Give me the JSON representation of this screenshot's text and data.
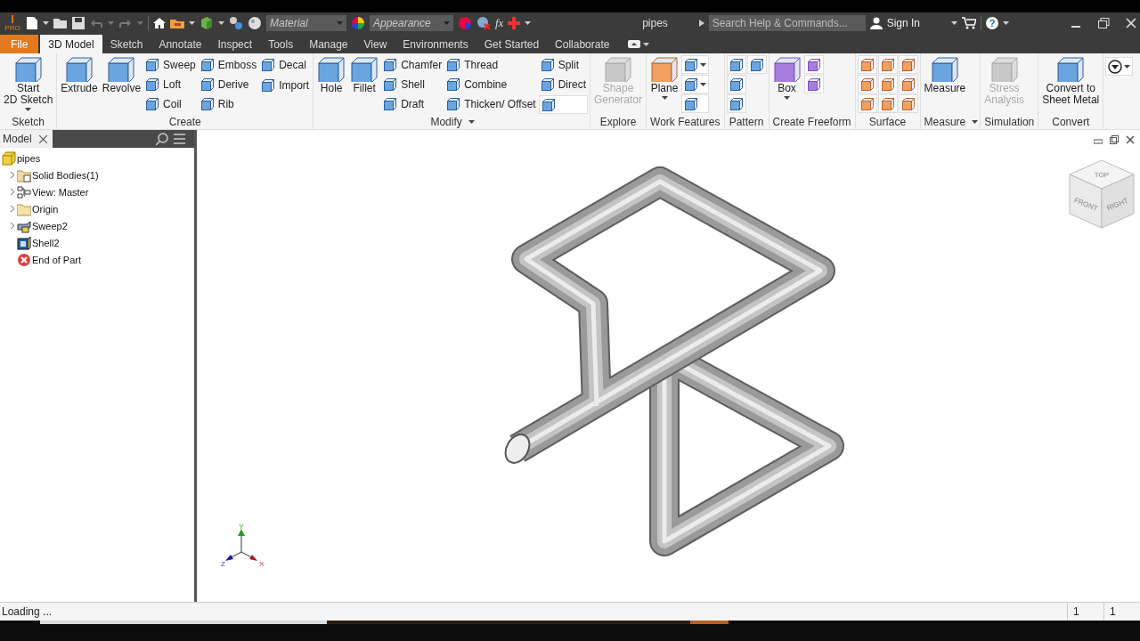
{
  "app_logo": {
    "letter": "I",
    "edition": "PRO"
  },
  "quick_access": {
    "material_placeholder": "Material",
    "appearance_placeholder": "Appearance",
    "formula_button": "fx"
  },
  "window": {
    "title": "pipes"
  },
  "search": {
    "placeholder": "Search Help & Commands..."
  },
  "account": {
    "sign_in": "Sign In",
    "help": "?"
  },
  "tabs": [
    {
      "label": "File",
      "kind": "file",
      "selected": false
    },
    {
      "label": "3D Model",
      "kind": "tab",
      "selected": true
    },
    {
      "label": "Sketch",
      "kind": "tab",
      "selected": false
    },
    {
      "label": "Annotate",
      "kind": "tab",
      "selected": false
    },
    {
      "label": "Inspect",
      "kind": "tab",
      "selected": false
    },
    {
      "label": "Tools",
      "kind": "tab",
      "selected": false
    },
    {
      "label": "Manage",
      "kind": "tab",
      "selected": false
    },
    {
      "label": "View",
      "kind": "tab",
      "selected": false
    },
    {
      "label": "Environments",
      "kind": "tab",
      "selected": false
    },
    {
      "label": "Get Started",
      "kind": "tab",
      "selected": false
    },
    {
      "label": "Collaborate",
      "kind": "tab",
      "selected": false
    }
  ],
  "ribbon": [
    {
      "title": "Sketch",
      "menu": false,
      "columns": [
        [
          {
            "kind": "large",
            "label": "Start\n2D Sketch",
            "dropdown": true,
            "disabled": false
          }
        ]
      ]
    },
    {
      "title": "Create",
      "menu": false,
      "columns": [
        [
          {
            "kind": "large",
            "label": "Extrude",
            "dropdown": false,
            "disabled": false
          }
        ],
        [
          {
            "kind": "large",
            "label": "Revolve",
            "dropdown": false,
            "disabled": false
          }
        ],
        [
          {
            "kind": "small",
            "label": "Sweep"
          },
          {
            "kind": "small",
            "label": "Loft"
          },
          {
            "kind": "small",
            "label": "Coil"
          }
        ],
        [
          {
            "kind": "small",
            "label": "Emboss"
          },
          {
            "kind": "small",
            "label": "Derive"
          },
          {
            "kind": "small",
            "label": "Rib"
          }
        ],
        [
          {
            "kind": "small",
            "label": "Decal"
          },
          {
            "kind": "small",
            "label": "Import"
          }
        ]
      ]
    },
    {
      "title": "Modify",
      "menu": true,
      "columns": [
        [
          {
            "kind": "large",
            "label": "Hole",
            "dropdown": false,
            "disabled": false
          }
        ],
        [
          {
            "kind": "large",
            "label": "Fillet",
            "dropdown": false,
            "disabled": false
          }
        ],
        [
          {
            "kind": "small",
            "label": "Chamfer"
          },
          {
            "kind": "small",
            "label": "Shell"
          },
          {
            "kind": "small",
            "label": "Draft"
          }
        ],
        [
          {
            "kind": "small",
            "label": "Thread"
          },
          {
            "kind": "small",
            "label": "Combine"
          },
          {
            "kind": "small",
            "label": "Thicken/ Offset"
          }
        ],
        [
          {
            "kind": "small",
            "label": "Split"
          },
          {
            "kind": "small",
            "label": "Direct"
          },
          {
            "kind": "icon",
            "dropdown": false
          }
        ]
      ]
    },
    {
      "title": "Explore",
      "menu": false,
      "columns": [
        [
          {
            "kind": "large",
            "label": "Shape\nGenerator",
            "dropdown": false,
            "disabled": true
          }
        ]
      ]
    },
    {
      "title": "Work Features",
      "menu": false,
      "columns": [
        [
          {
            "kind": "large",
            "label": "Plane",
            "dropdown": true,
            "disabled": false
          }
        ],
        [
          {
            "kind": "icon",
            "dropdown": true
          },
          {
            "kind": "icon",
            "dropdown": true
          },
          {
            "kind": "icon",
            "dropdown": false
          }
        ]
      ]
    },
    {
      "title": "Pattern",
      "menu": false,
      "columns": [
        [
          {
            "kind": "icon",
            "dropdown": false
          },
          {
            "kind": "icon",
            "dropdown": false
          },
          {
            "kind": "icon",
            "dropdown": false
          }
        ],
        [
          {
            "kind": "icon",
            "dropdown": false
          }
        ]
      ]
    },
    {
      "title": "Create Freeform",
      "menu": false,
      "columns": [
        [
          {
            "kind": "large",
            "label": "Box",
            "dropdown": true,
            "disabled": false
          }
        ],
        [
          {
            "kind": "icon",
            "dropdown": false
          },
          {
            "kind": "icon",
            "dropdown": false
          }
        ]
      ]
    },
    {
      "title": "Surface",
      "menu": false,
      "columns": [
        [
          {
            "kind": "icon",
            "dropdown": false
          },
          {
            "kind": "icon",
            "dropdown": false
          },
          {
            "kind": "icon",
            "dropdown": false
          }
        ],
        [
          {
            "kind": "icon",
            "dropdown": false
          },
          {
            "kind": "icon",
            "dropdown": false
          },
          {
            "kind": "icon",
            "dropdown": false
          }
        ],
        [
          {
            "kind": "icon",
            "dropdown": false
          },
          {
            "kind": "icon",
            "dropdown": false
          },
          {
            "kind": "icon",
            "dropdown": false
          }
        ]
      ]
    },
    {
      "title": "Measure",
      "menu": true,
      "columns": [
        [
          {
            "kind": "large",
            "label": "Measure",
            "dropdown": false,
            "disabled": false
          }
        ]
      ]
    },
    {
      "title": "Simulation",
      "menu": false,
      "columns": [
        [
          {
            "kind": "large",
            "label": "Stress\nAnalysis",
            "dropdown": false,
            "disabled": true
          }
        ]
      ]
    },
    {
      "title": "Convert",
      "menu": false,
      "columns": [
        [
          {
            "kind": "large",
            "label": "Convert to\nSheet Metal",
            "dropdown": false,
            "disabled": false
          }
        ]
      ]
    }
  ],
  "browser": {
    "tab": "Model",
    "tree": [
      {
        "label": "pipes",
        "kind": "part",
        "expander": false,
        "children": [
          {
            "label": "Solid Bodies(1)",
            "kind": "bodies",
            "expander": true
          },
          {
            "label": "View: Master",
            "kind": "view",
            "expander": true
          },
          {
            "label": "Origin",
            "kind": "folder",
            "expander": true
          },
          {
            "label": "Sweep2",
            "kind": "sweep",
            "expander": true
          },
          {
            "label": "Shell2",
            "kind": "shell",
            "expander": false
          },
          {
            "label": "End of Part",
            "kind": "end",
            "expander": false
          }
        ]
      }
    ]
  },
  "view_cube": {
    "top": "TOP",
    "front": "FRONT",
    "right": "RIGHT"
  },
  "triad": {
    "x": "X",
    "y": "Y",
    "z": "Z"
  },
  "status_bar": {
    "message": "Loading ...",
    "cells": [
      "1",
      "1"
    ]
  }
}
